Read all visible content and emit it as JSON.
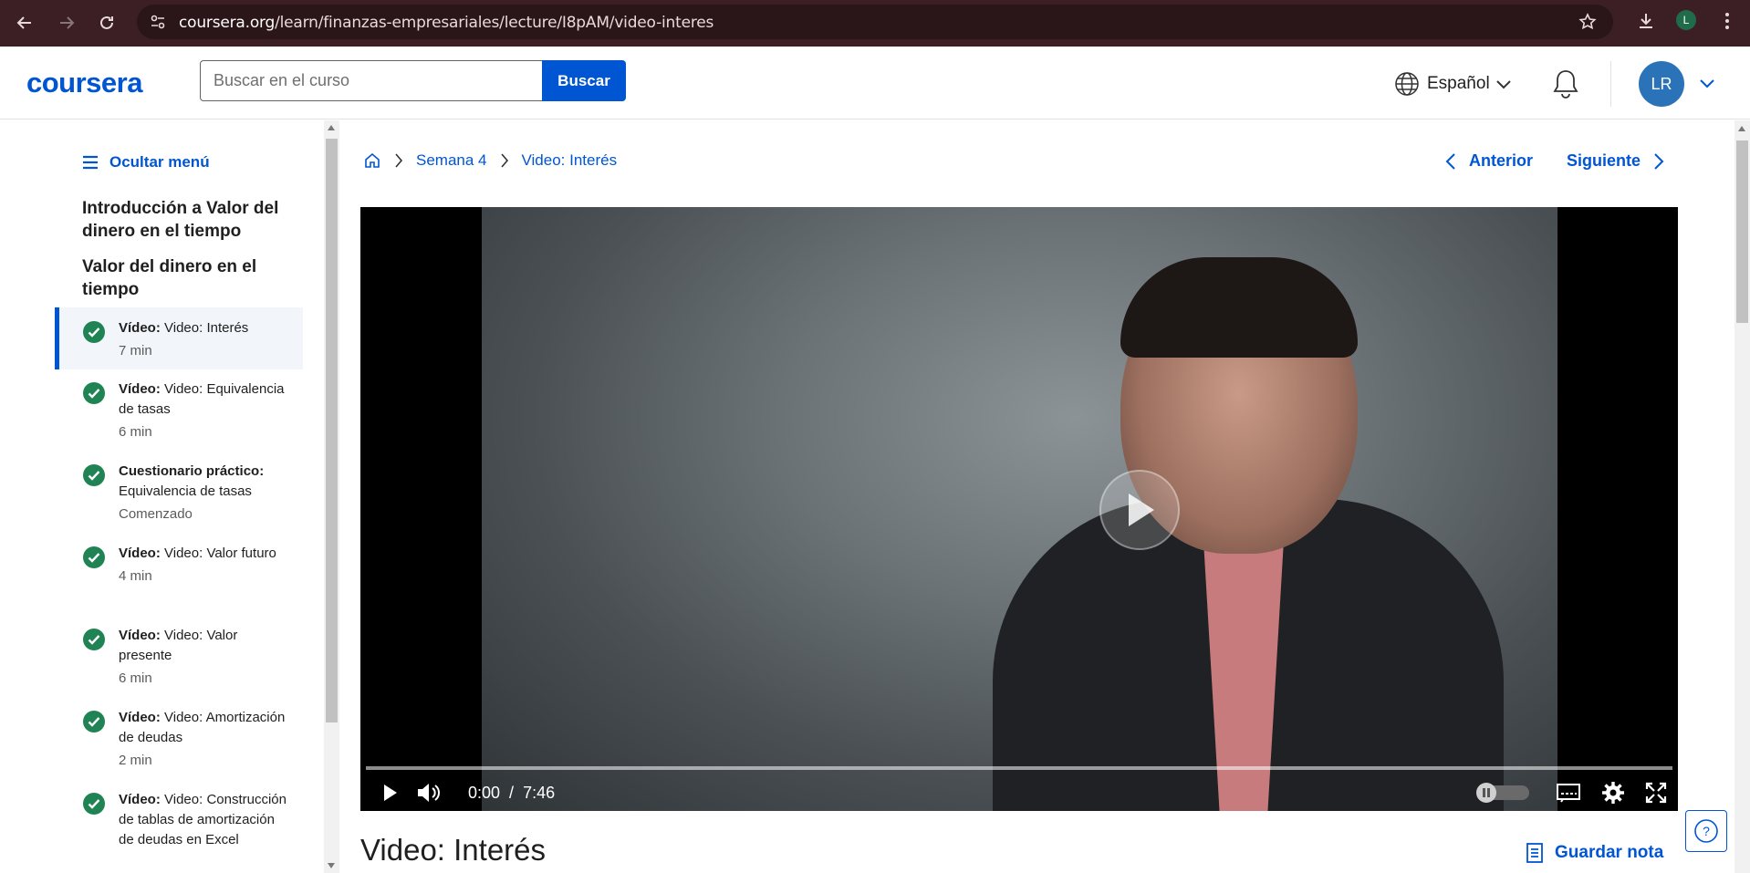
{
  "browser": {
    "url_host": "coursera.org",
    "url_path": "/learn/finanzas-empresariales/lecture/I8pAM/video-interes",
    "profile_initial": "L"
  },
  "header": {
    "logo": "coursera",
    "search_placeholder": "Buscar en el curso",
    "search_button": "Buscar",
    "language": "Español",
    "avatar_initials": "LR"
  },
  "sidebar": {
    "hide_menu": "Ocultar menú",
    "section1": "Introducción a Valor del dinero en el tiempo",
    "section2": "Valor del dinero en el tiempo",
    "items": [
      {
        "type": "Vídeo:",
        "title": "Video: Interés",
        "meta": "7 min"
      },
      {
        "type": "Vídeo:",
        "title": "Video: Equivalencia de tasas",
        "meta": "6 min"
      },
      {
        "type": "Cuestionario práctico:",
        "title": "Equivalencia de tasas",
        "meta": "Comenzado"
      },
      {
        "type": "Vídeo:",
        "title": "Video: Valor futuro",
        "meta": "4 min"
      },
      {
        "type": "Vídeo:",
        "title": "Video: Valor presente",
        "meta": "6 min"
      },
      {
        "type": "Vídeo:",
        "title": "Video: Amortización de deudas",
        "meta": "2 min"
      },
      {
        "type": "Vídeo:",
        "title": "Video: Construcción de tablas de amortización de deudas en Excel",
        "meta": ""
      }
    ]
  },
  "breadcrumb": {
    "week": "Semana 4",
    "current": "Video: Interés"
  },
  "nav": {
    "previous": "Anterior",
    "next": "Siguiente"
  },
  "player": {
    "current_time": "0:00",
    "separator": "/",
    "duration": "7:46",
    "progress_fraction": 0
  },
  "content": {
    "title": "Video: Interés",
    "save_note": "Guardar nota"
  },
  "colors": {
    "brand": "#0056d2",
    "complete": "#1f8354"
  }
}
